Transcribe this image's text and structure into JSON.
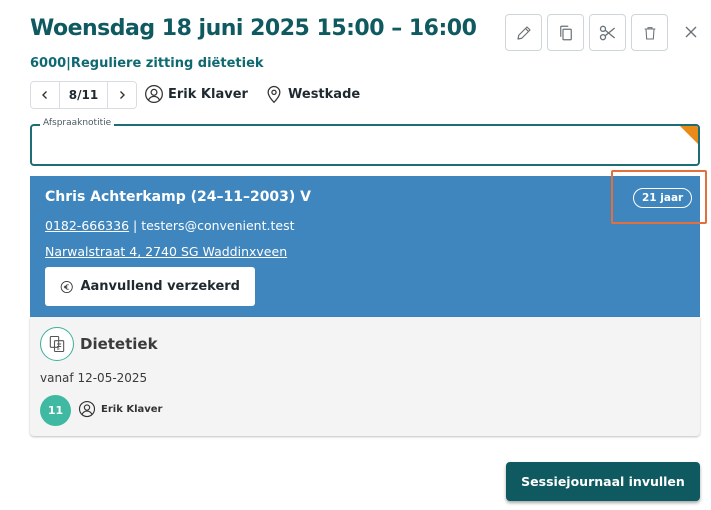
{
  "appointment": {
    "title": "Woensdag 18 juni 2025 15:00 – 16:00",
    "subtitle": "6000|Reguliere zitting diëtetiek"
  },
  "toolbar": {
    "edit_icon": "pencil-icon",
    "copy_icon": "copy-icon",
    "cut_icon": "scissors-icon",
    "delete_icon": "trash-icon",
    "close_icon": "close-icon"
  },
  "pager": {
    "count": "8/11"
  },
  "meta": {
    "practitioner": "Erik Klaver",
    "location": "Westkade"
  },
  "note": {
    "label": "Afspraaknotitie",
    "value": "",
    "corner_color": "#e98a19"
  },
  "patient": {
    "name": "Chris Achterkamp (24–11–2003) V",
    "age": "21 jaar",
    "phone": "0182-666336",
    "separator": " | ",
    "email": "testers@convenient.test",
    "address": "Narwalstraat 4, 2740 SG Waddinxveen",
    "insurance_label": "Aanvullend verzekerd",
    "card_color": "#3e86bd"
  },
  "treatment": {
    "title": "Dietetiek",
    "since": "vanaf 12-05-2025",
    "count": "11",
    "practitioner": "Erik Klaver"
  },
  "actions": {
    "primary_label": "Sessiejournaal invullen",
    "primary_color": "#0f5a60"
  }
}
